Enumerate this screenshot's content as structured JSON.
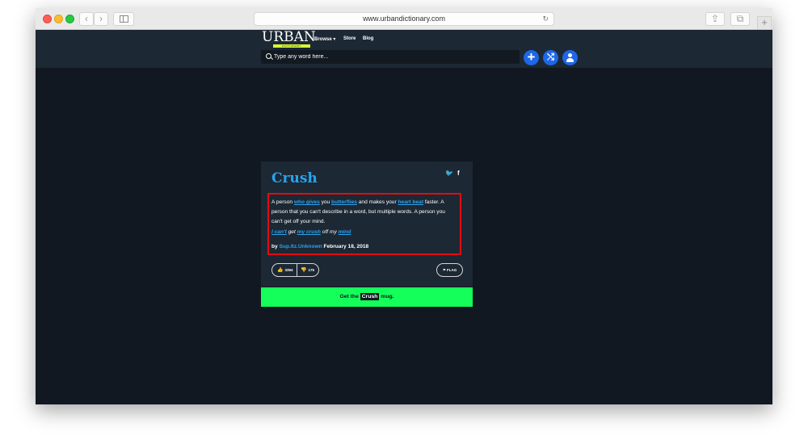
{
  "browser": {
    "url": "www.urbandictionary.com",
    "back": "‹",
    "forward": "›",
    "share": "⇪",
    "tabs": "⧉",
    "new_tab": "+",
    "reload": "↻"
  },
  "header": {
    "logo": "URBAN",
    "logo_sub": "DICTIONARY",
    "nav": [
      "Browse ▾",
      "Store",
      "Blog"
    ],
    "search_placeholder": "Type any word here...",
    "add_label": "+",
    "random_label": "⤭"
  },
  "definition": {
    "word": "Crush",
    "meaning": {
      "p1": "A person ",
      "l1": "who gives",
      "p2": " you ",
      "l2": "butterflies",
      "p3": " and makes your ",
      "l3": "heart beat",
      "p4": " faster. A person that you can't describe in a word, but multiple words. A person you can't get off your mind."
    },
    "example": {
      "l1": "I can't",
      "p1": " get ",
      "l2": "my crush",
      "p2": " off my ",
      "l3": "mind"
    },
    "contributor_prefix": "by ",
    "author": "Sup.Itz.Unknown",
    "date": " February 18, 2018",
    "upvotes": "3394",
    "downvotes": "175",
    "flag_label": "FLAG",
    "social": {
      "twitter": "🐦",
      "facebook": "f"
    }
  },
  "mug_banner": {
    "prefix": "Get the ",
    "word": "Crush",
    "suffix": " mug."
  },
  "colors": {
    "accent": "#2aa3ef",
    "banner": "#14ff5a",
    "highlight_border": "#e40b12",
    "button_blue": "#1e67e6"
  }
}
